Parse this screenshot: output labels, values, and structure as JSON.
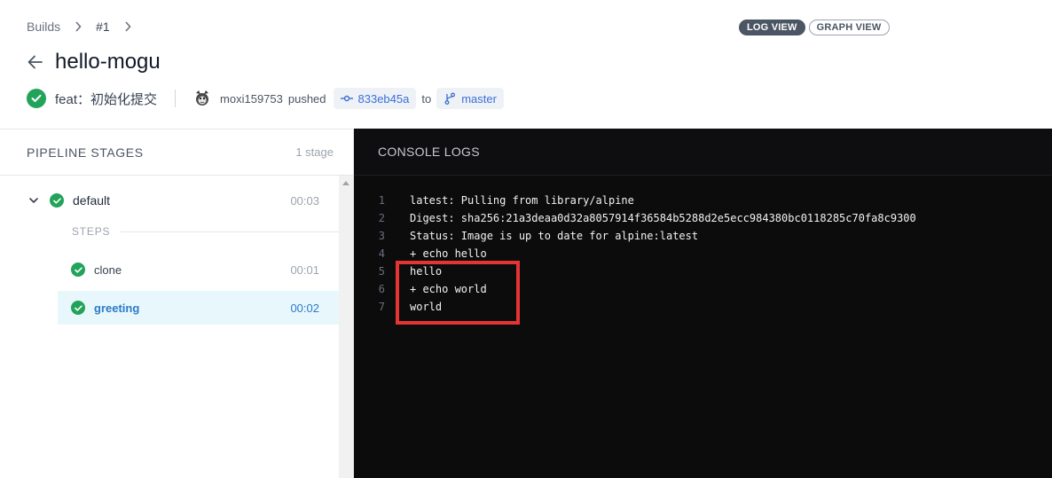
{
  "breadcrumb": {
    "items": [
      "Builds",
      "#1"
    ]
  },
  "view_toggle": {
    "log_label": "LOG VIEW",
    "graph_label": "GRAPH VIEW",
    "active": "log"
  },
  "header": {
    "title": "hello-mogu"
  },
  "commit": {
    "status": "success",
    "message": "feat：初始化提交",
    "author": "moxi159753",
    "action": "pushed",
    "sha": "833eb45a",
    "to_text": "to",
    "branch": "master"
  },
  "pipeline": {
    "title": "PIPELINE STAGES",
    "count_label": "1 stage",
    "stages": [
      {
        "name": "default",
        "time": "00:03",
        "status": "success",
        "expanded": true,
        "steps_label": "STEPS",
        "steps": [
          {
            "name": "clone",
            "time": "00:01",
            "status": "success",
            "selected": false
          },
          {
            "name": "greeting",
            "time": "00:02",
            "status": "success",
            "selected": true
          }
        ]
      }
    ]
  },
  "console": {
    "title": "CONSOLE LOGS",
    "lines": [
      {
        "n": "1",
        "text": "latest: Pulling from library/alpine"
      },
      {
        "n": "2",
        "text": "Digest: sha256:21a3deaa0d32a8057914f36584b5288d2e5ecc984380bc0118285c70fa8c9300"
      },
      {
        "n": "3",
        "text": "Status: Image is up to date for alpine:latest"
      },
      {
        "n": "4",
        "text": "+ echo hello"
      },
      {
        "n": "5",
        "text": "hello"
      },
      {
        "n": "6",
        "text": "+ echo world"
      },
      {
        "n": "7",
        "text": "world"
      }
    ]
  },
  "colors": {
    "success": "#22a35a",
    "accent": "#2b7bc9",
    "highlight": "#e53434",
    "console_bg": "#0c0c0d"
  }
}
